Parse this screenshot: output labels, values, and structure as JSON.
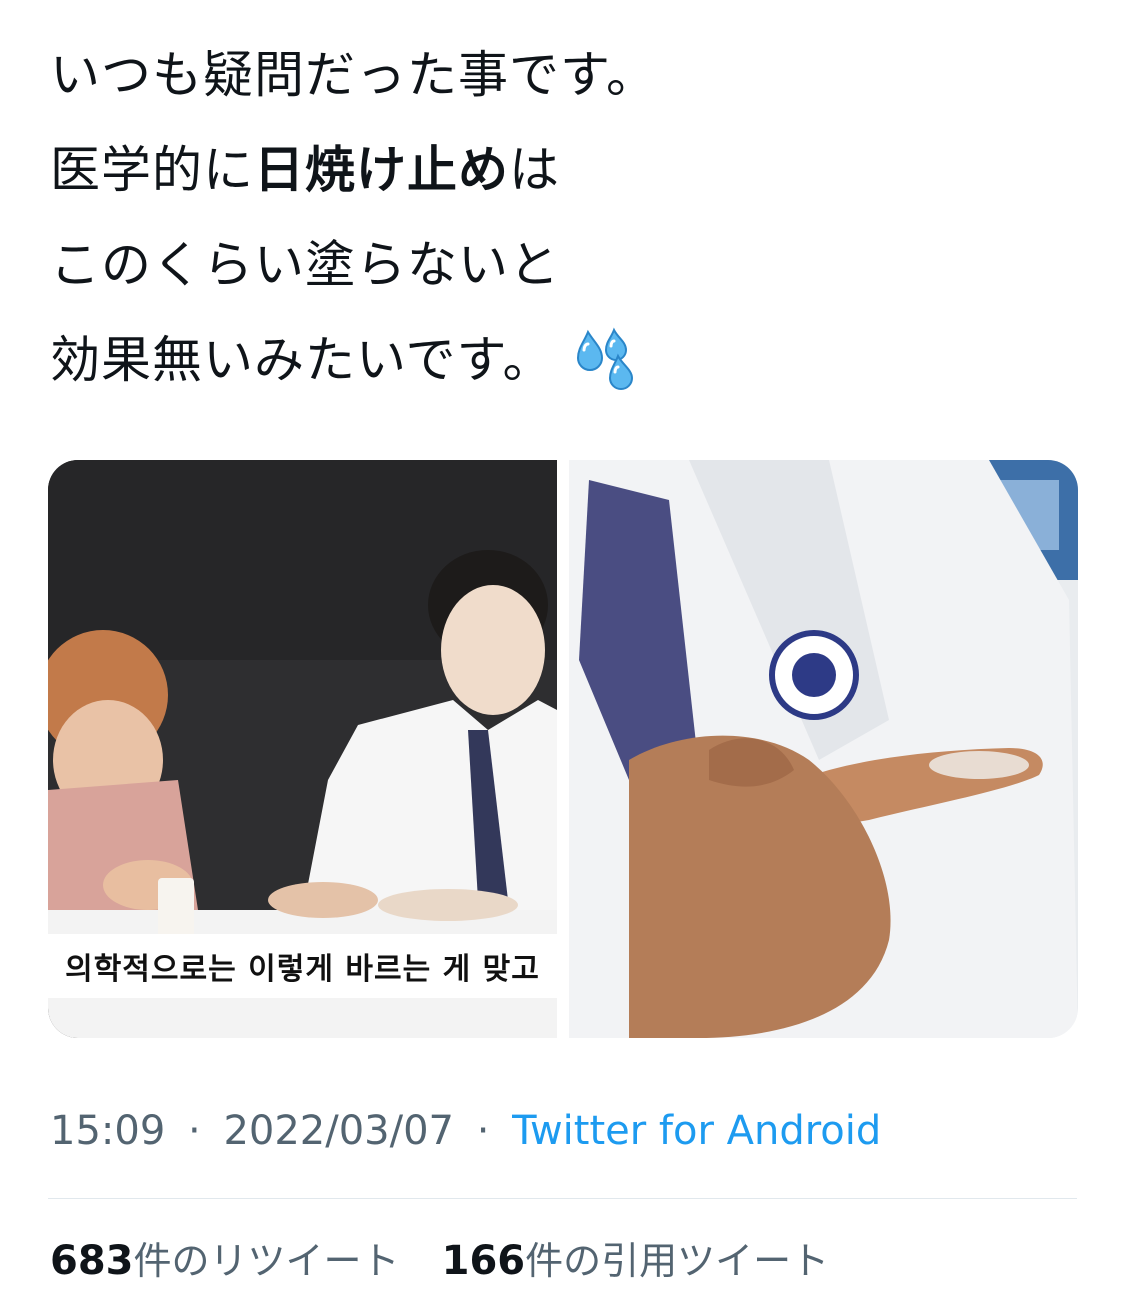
{
  "tweet": {
    "lines": [
      "いつも疑問だった事です。",
      "医学的に",
      "日焼け止め",
      "は",
      "このくらい塗らないと",
      "効果無いみたいです。"
    ],
    "emoji": "sweat-droplets-icon"
  },
  "media": {
    "left_caption": "의학적으로는 이렇게 바르는 게 맞고"
  },
  "meta": {
    "time": "15:09",
    "separator": "·",
    "date": "2022/03/07",
    "source": "Twitter for Android"
  },
  "stats": {
    "retweets_count": "683",
    "retweets_label": "件のリツイート",
    "quotes_count": "166",
    "quotes_label": "件の引用ツイート"
  },
  "colors": {
    "link": "#1d9bf0",
    "muted": "#536471",
    "text": "#0f1419"
  }
}
